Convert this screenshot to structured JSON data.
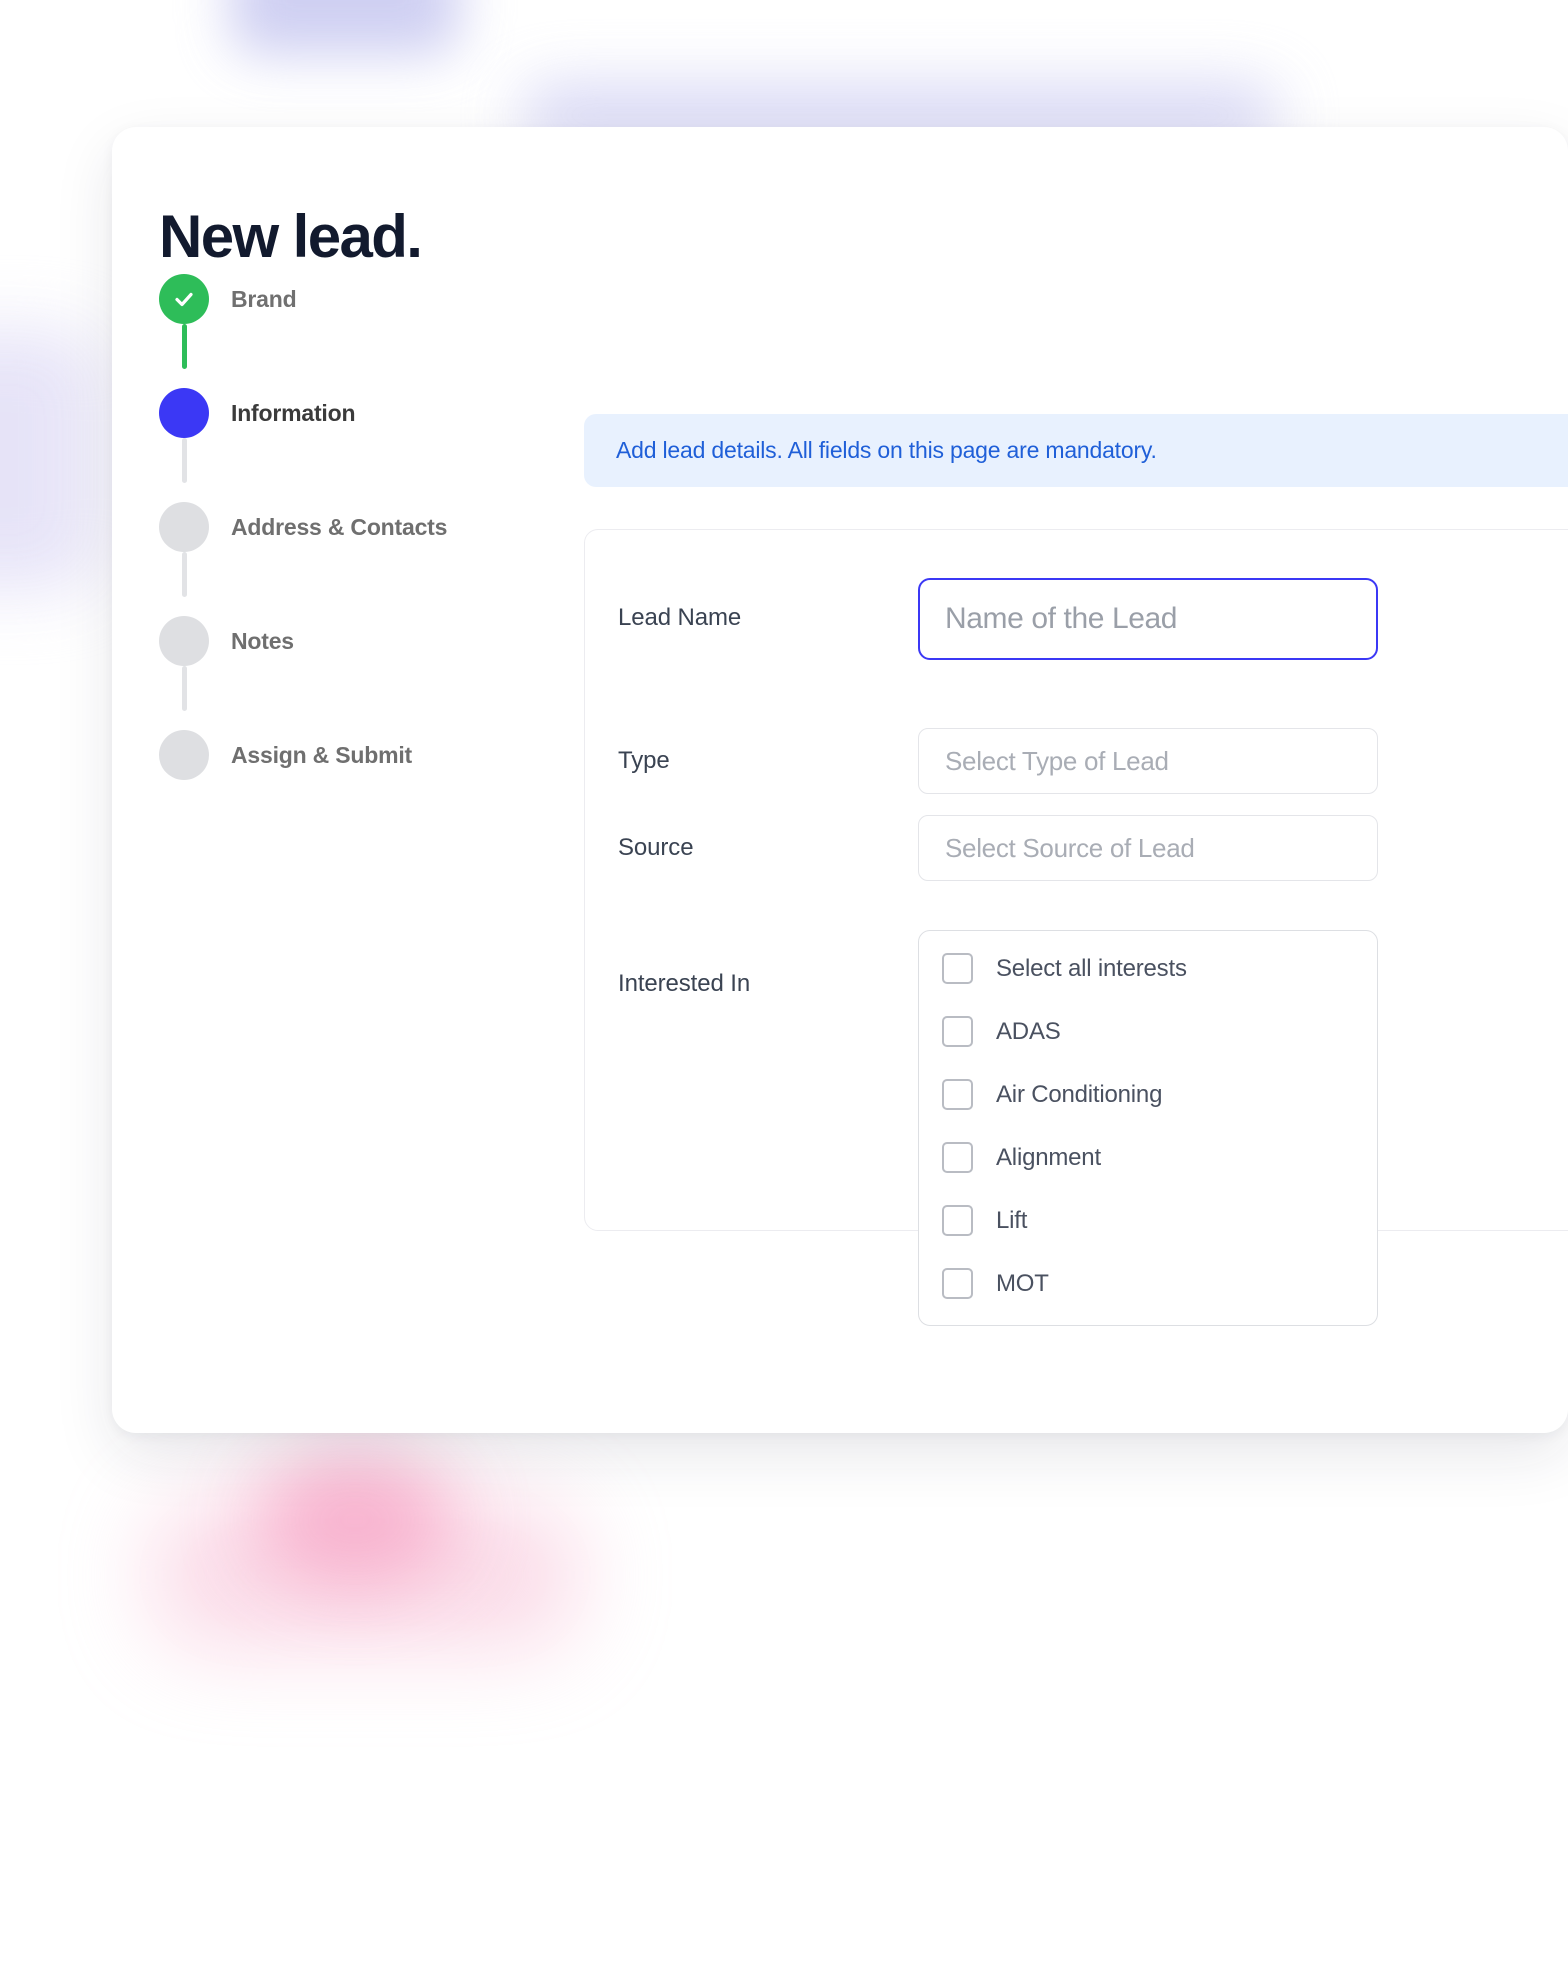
{
  "page": {
    "title": "New lead."
  },
  "stepper": {
    "steps": [
      {
        "label": "Brand",
        "state": "done",
        "icon": "check-icon"
      },
      {
        "label": "Information",
        "state": "active",
        "icon": ""
      },
      {
        "label": "Address & Contacts",
        "state": "todo",
        "icon": ""
      },
      {
        "label": "Notes",
        "state": "todo",
        "icon": ""
      },
      {
        "label": "Assign & Submit",
        "state": "todo",
        "icon": ""
      }
    ]
  },
  "banner": {
    "text": "Add lead details. All fields on this page are mandatory."
  },
  "form": {
    "lead_name": {
      "label": "Lead Name",
      "value": "",
      "placeholder": "Name of the Lead"
    },
    "type": {
      "label": "Type",
      "value": "",
      "placeholder": "Select Type of Lead"
    },
    "source": {
      "label": "Source",
      "value": "",
      "placeholder": "Select Source of Lead"
    },
    "interested_in": {
      "label": "Interested In",
      "options": [
        {
          "label": "Select all interests",
          "checked": false
        },
        {
          "label": "ADAS",
          "checked": false
        },
        {
          "label": "Air Conditioning",
          "checked": false
        },
        {
          "label": "Alignment",
          "checked": false
        },
        {
          "label": "Lift",
          "checked": false
        },
        {
          "label": "MOT",
          "checked": false
        }
      ]
    }
  },
  "colors": {
    "accent_blue": "#3b38f5",
    "success_green": "#2ebd59",
    "banner_bg": "#e8f1fe",
    "banner_text": "#1f5fd8",
    "step_idle": "#dedfe2"
  }
}
